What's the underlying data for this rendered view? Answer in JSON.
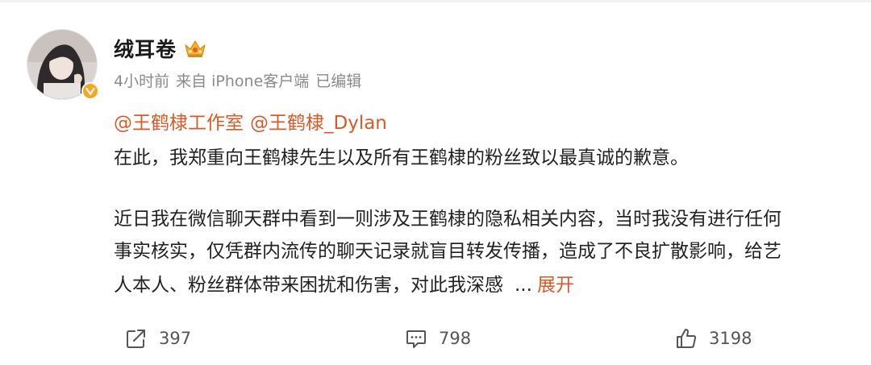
{
  "post": {
    "username": "绒耳卷",
    "meta": {
      "time": "4小时前",
      "source": "来自 iPhone客户端",
      "edited": "已编辑"
    },
    "mentions": [
      "@王鹤棣工作室",
      "@王鹤棣_Dylan"
    ],
    "paragraph1": "在此，我郑重向王鹤棣先生以及所有王鹤棣的粉丝致以最真诚的歉意。",
    "paragraph2_lines": [
      "近日我在微信聊天群中看到一则涉及王鹤棣的隐私相关内容，当时我没有进行任何",
      "事实核实，仅凭群内流传的聊天记录就盲目转发传播，造成了不良扩散影响，给艺",
      "人本人、粉丝群体带来困扰和伤害，对此我深感"
    ],
    "ellipsis": "...",
    "expand_label": "展开"
  },
  "actions": {
    "share_count": "397",
    "comment_count": "798",
    "like_count": "3198"
  },
  "colors": {
    "link": "#d95a28",
    "meta": "#8a8a8a",
    "text": "#222222",
    "badge": "#f5a623"
  },
  "icons": {
    "verified": "verified-badge-icon",
    "vip": "crown-icon",
    "share": "share-icon",
    "comment": "comment-icon",
    "like": "thumbs-up-icon"
  }
}
